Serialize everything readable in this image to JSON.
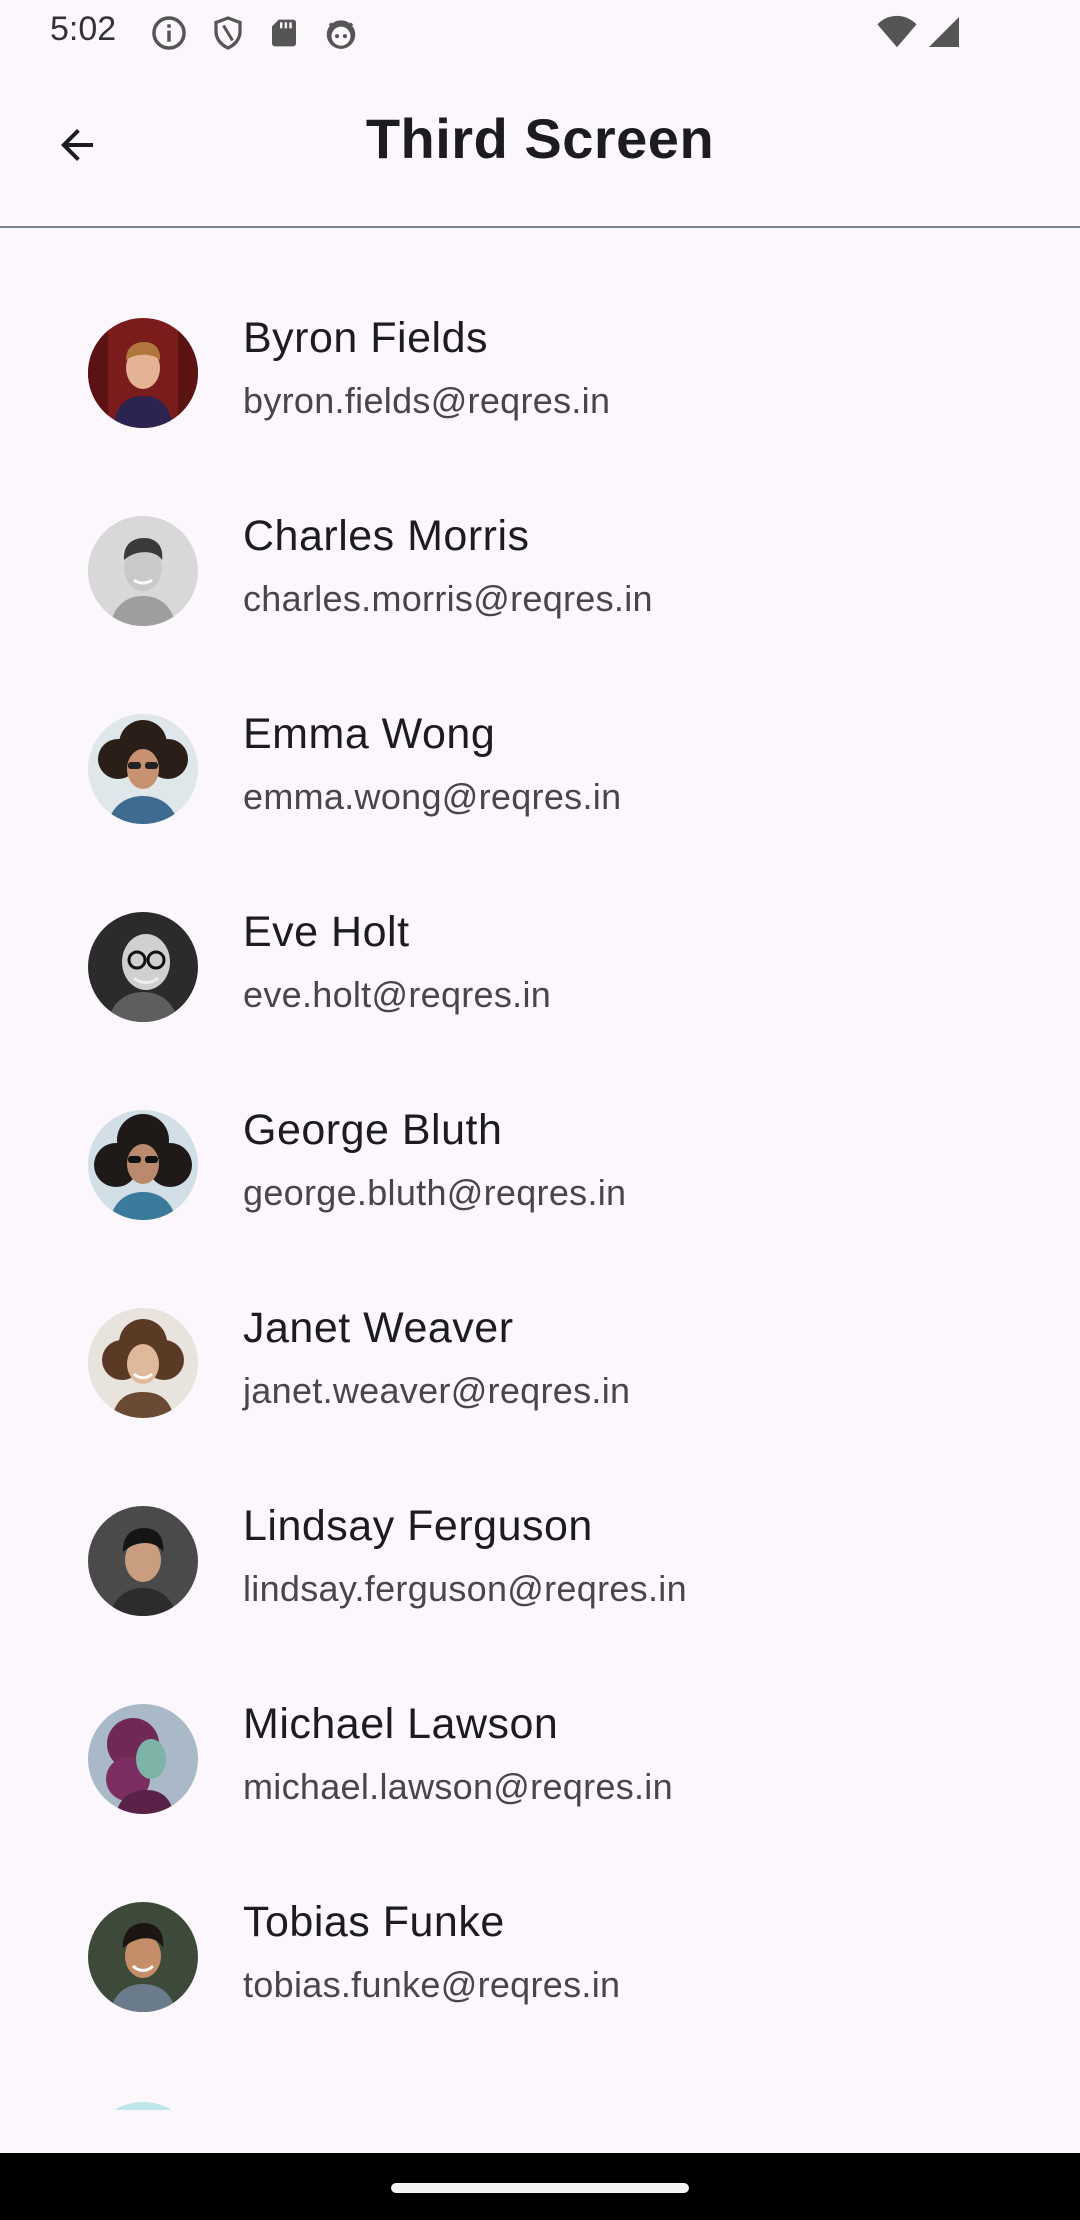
{
  "status_bar": {
    "time": "5:02",
    "left_icons": [
      "info-icon",
      "shield-icon",
      "sd-card-icon",
      "android-face-icon"
    ],
    "right_icons": [
      "wifi-icon",
      "cellular-signal-icon"
    ]
  },
  "app_bar": {
    "title": "Third Screen",
    "back_icon": "arrow-back-icon"
  },
  "users": [
    {
      "name": "Byron Fields",
      "email": "byron.fields@reqres.in"
    },
    {
      "name": "Charles Morris",
      "email": "charles.morris@reqres.in"
    },
    {
      "name": "Emma Wong",
      "email": "emma.wong@reqres.in"
    },
    {
      "name": "Eve Holt",
      "email": "eve.holt@reqres.in"
    },
    {
      "name": "George Bluth",
      "email": "george.bluth@reqres.in"
    },
    {
      "name": "Janet Weaver",
      "email": "janet.weaver@reqres.in"
    },
    {
      "name": "Lindsay Ferguson",
      "email": "lindsay.ferguson@reqres.in"
    },
    {
      "name": "Michael Lawson",
      "email": "michael.lawson@reqres.in"
    },
    {
      "name": "Tobias Funke",
      "email": "tobias.funke@reqres.in"
    }
  ],
  "colors": {
    "background": "#fcf7fc",
    "title_text": "#1c1b1f",
    "email_text": "#49454f",
    "divider": "#7a8591"
  }
}
